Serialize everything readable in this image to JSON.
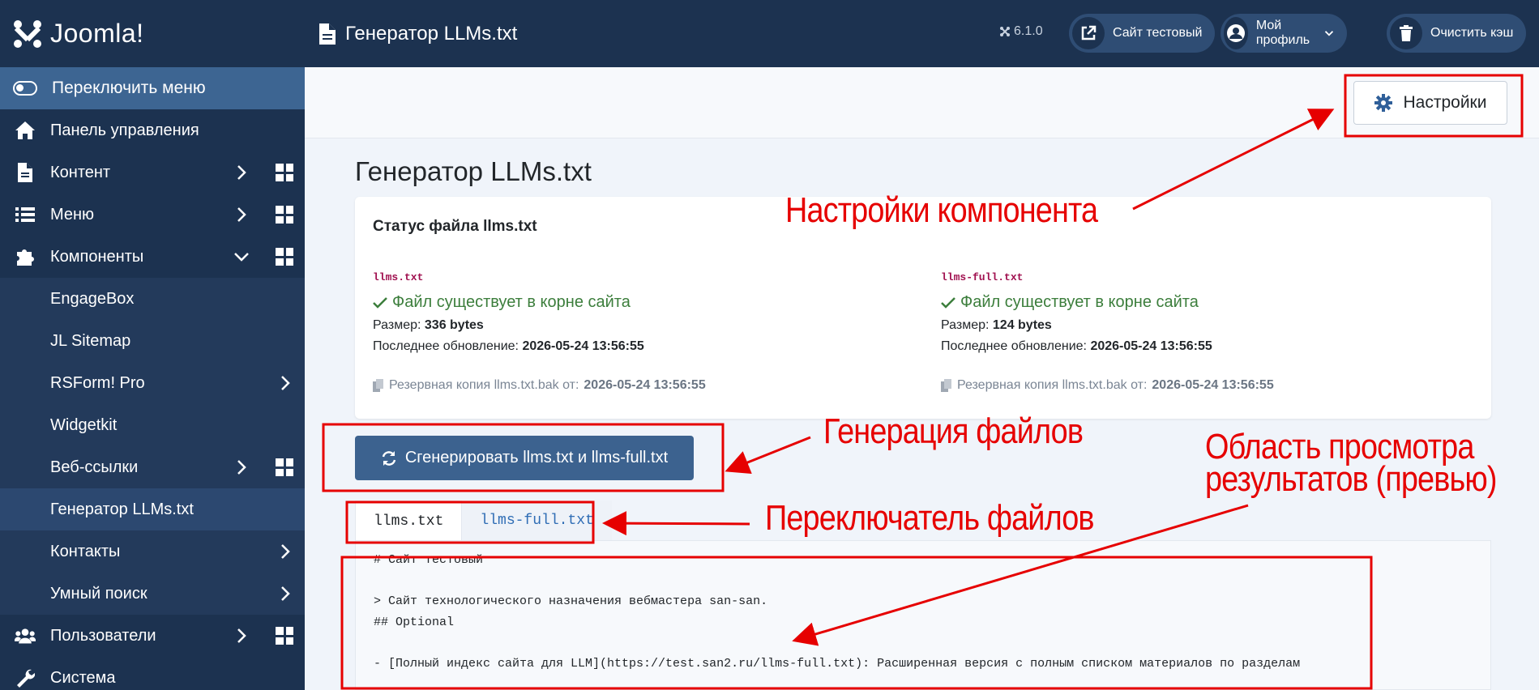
{
  "brand": {
    "name": "Joomla!"
  },
  "sidebar": {
    "toggle_label": "Переключить меню",
    "items": [
      {
        "label": "Панель управления",
        "icon": "home-icon"
      },
      {
        "label": "Контент",
        "icon": "file-icon"
      },
      {
        "label": "Меню",
        "icon": "list-icon"
      },
      {
        "label": "Компоненты",
        "icon": "puzzle-icon"
      },
      {
        "label": "EngageBox"
      },
      {
        "label": "JL Sitemap"
      },
      {
        "label": "RSForm! Pro"
      },
      {
        "label": "Widgetkit"
      },
      {
        "label": "Веб-ссылки"
      },
      {
        "label": "Генератор LLMs.txt"
      },
      {
        "label": "Контакты"
      },
      {
        "label": "Умный поиск"
      },
      {
        "label": "Пользователи",
        "icon": "users-icon"
      },
      {
        "label": "Система",
        "icon": "wrench-icon"
      }
    ]
  },
  "header": {
    "title": "Генератор LLMs.txt",
    "version": "6.1.0",
    "site_button": "Сайт тестовый",
    "profile_button": "Мой профиль",
    "cache_button": "Очистить кэш"
  },
  "toolbar": {
    "settings_label": "Настройки"
  },
  "main": {
    "heading": "Генератор LLMs.txt",
    "status_card": {
      "title": "Статус файла llms.txt",
      "files": [
        {
          "name": "llms.txt",
          "status": "Файл существует в корне сайта",
          "size_label": "Размер:",
          "size_value": "336 bytes",
          "updated_label": "Последнее обновление:",
          "updated_value": "2026-05-24 13:56:55",
          "backup_label": "Резервная копия llms.txt.bak от:",
          "backup_value": "2026-05-24 13:56:55"
        },
        {
          "name": "llms-full.txt",
          "status": "Файл существует в корне сайта",
          "size_label": "Размер:",
          "size_value": "124 bytes",
          "updated_label": "Последнее обновление:",
          "updated_value": "2026-05-24 13:56:55",
          "backup_label": "Резервная копия llms.txt.bak от:",
          "backup_value": "2026-05-24 13:56:55"
        }
      ]
    },
    "generate_button": "Сгенерировать llms.txt и llms-full.txt",
    "tabs": [
      {
        "label": "llms.txt"
      },
      {
        "label": "llms-full.txt"
      }
    ],
    "preview_lines": [
      "# Сайт тестовый",
      "",
      "> Сайт технологического назначения вебмастера san-san.",
      "## Optional",
      "",
      "- [Полный индекс сайта для LLM](https://test.san2.ru/llms-full.txt): Расширенная версия с полным списком материалов по разделам"
    ]
  },
  "annotations": {
    "settings": "Настройки компонента",
    "generate": "Генерация файлов",
    "preview_line1": "Область просмотра",
    "preview_line2": "результатов (превью)",
    "switcher": "Переключатель файлов",
    "color": "#e60000"
  }
}
